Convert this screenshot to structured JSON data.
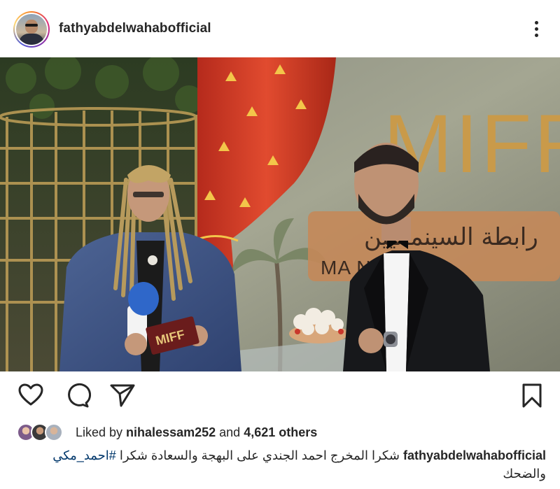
{
  "post": {
    "username": "fathyabdelwahabofficial",
    "more_icon": "more-vertical-icon",
    "photo": {
      "signage": "MIFF",
      "banner_ar": "رابطة السينمائيين",
      "banner_en": "MA  NATIONA",
      "card_text": "MIFF"
    },
    "actions": {
      "like_icon": "heart-icon",
      "comment_icon": "comment-icon",
      "share_icon": "send-icon",
      "save_icon": "bookmark-icon"
    },
    "likes": {
      "prefix": "Liked by ",
      "user": "nihalessam252",
      "middle": " and ",
      "count": "4,621 others"
    },
    "caption": {
      "user": "fathyabdelwahabofficial",
      "text_before": " والضحك ",
      "text_main": "شكرا المخرج احمد الجندي على البهجة والسعادة",
      "hashtag": "#احمد_مكي",
      "thanks": "شكرا"
    }
  },
  "colors": {
    "text": "#262626",
    "hashtag": "#00376b",
    "curtain": "#d7402a",
    "sign_gold": "#c99a4a"
  }
}
